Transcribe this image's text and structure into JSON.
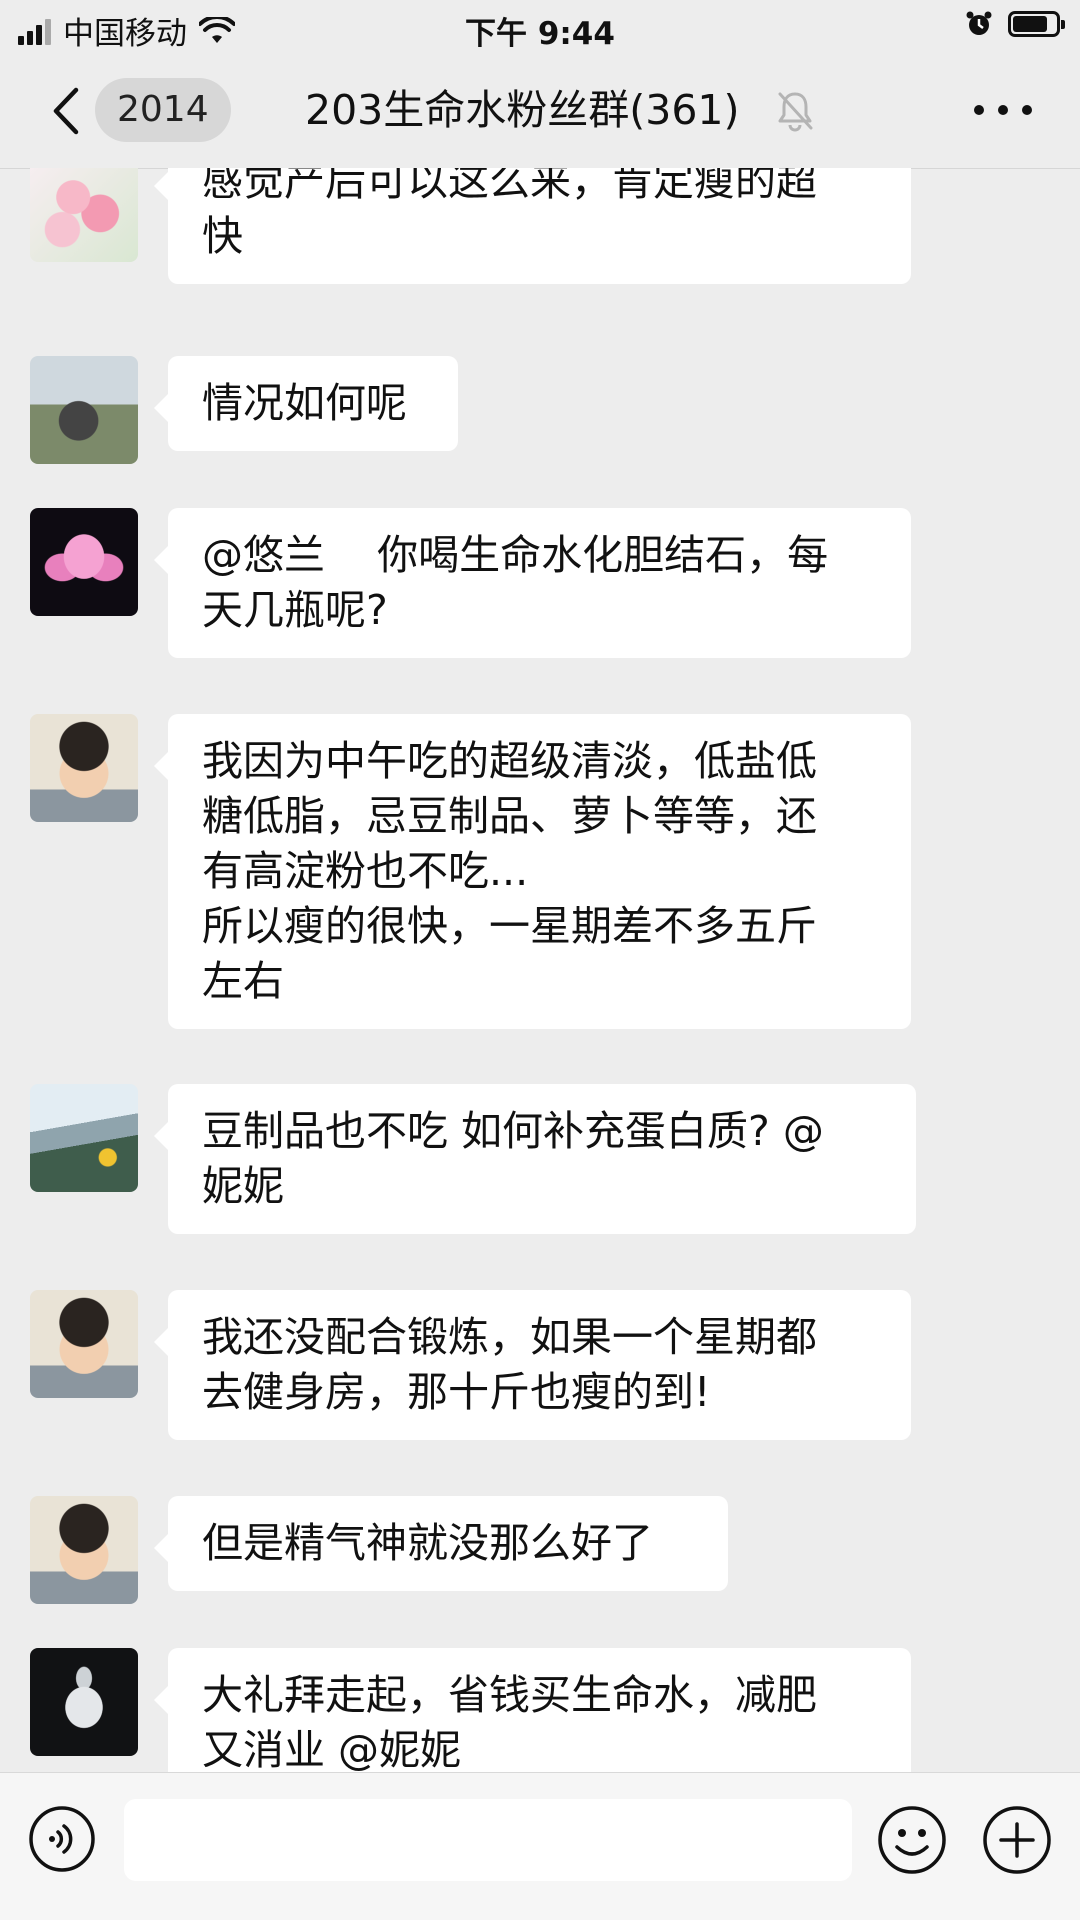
{
  "status_bar": {
    "carrier": "中国移动",
    "time": "下午 9:44",
    "signal_icon": "signal-bars-icon",
    "wifi_icon": "wifi-icon",
    "alarm_icon": "alarm-clock-icon",
    "battery_icon": "battery-icon",
    "battery_level": 0.8
  },
  "nav": {
    "back_icon": "chevron-left-icon",
    "unread_count": "2014",
    "title": "203生命水粉丝群(361)",
    "mute_icon": "bell-muted-icon",
    "more_icon": "ellipsis-icon"
  },
  "messages": [
    {
      "avatar": "pink-flower-avatar",
      "text": "感觉产后可以这么来，肯定瘦的超\n快"
    },
    {
      "avatar": "landscape-photo-avatar",
      "text": "情况如何呢"
    },
    {
      "avatar": "lotus-avatar",
      "text": "@悠兰    你喝生命水化胆结石，每\n天几瓶呢?"
    },
    {
      "avatar": "child-photo-avatar",
      "text": "我因为中午吃的超级清淡，低盐低\n糖低脂，忌豆制品、萝卜等等，还\n有高淀粉也不吃...\n所以瘦的很快，一星期差不多五斤\n左右"
    },
    {
      "avatar": "mountain-photo-avatar",
      "text": "豆制品也不吃 如何补充蛋白质? @\n妮妮"
    },
    {
      "avatar": "child-photo-avatar",
      "text": "我还没配合锻炼，如果一个星期都\n去健身房，那十斤也瘦的到!"
    },
    {
      "avatar": "child-photo-avatar",
      "text": "但是精气神就没那么好了"
    },
    {
      "avatar": "crystal-statue-avatar",
      "text": "大礼拜走起，省钱买生命水，减肥\n又消业 @妮妮"
    }
  ],
  "input_bar": {
    "voice_icon": "voice-input-icon",
    "message_value": "",
    "emoji_icon": "emoji-icon",
    "plus_icon": "plus-circle-icon"
  },
  "colors": {
    "background": "#ededed",
    "bubble": "#ffffff",
    "text": "#111111",
    "badge": "#d7d7d7"
  }
}
